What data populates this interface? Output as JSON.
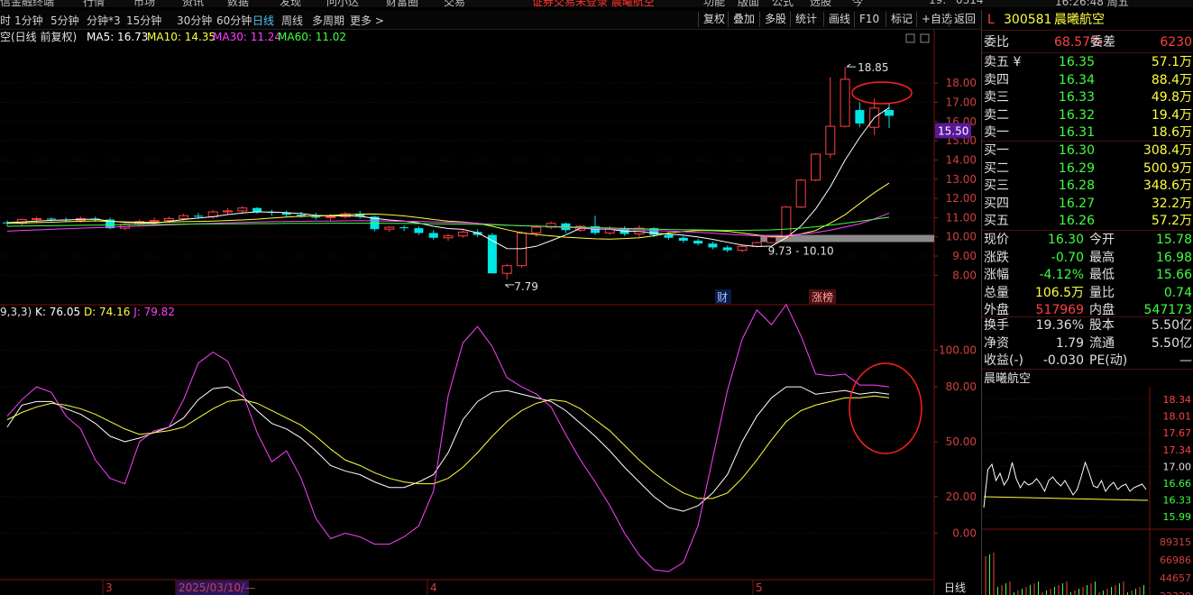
{
  "menubar": {
    "items": [
      "信金融终端",
      "行情",
      "市场",
      "资讯",
      "数据",
      "发现",
      "问小达",
      "财富圈",
      "交易",
      "证券交易未登录  晨曦航空",
      "功能",
      "版面",
      "公式",
      "选股",
      "今",
      "19:",
      "0314",
      "16:26:48 周五"
    ]
  },
  "toolbar": {
    "periods": [
      "时",
      "1分钟",
      "5分钟",
      "分钟*3",
      "15分钟",
      "30分钟",
      "60分钟",
      "日线",
      "周线",
      "多周期",
      "更多 >"
    ],
    "active_period": "日线",
    "buttons": [
      "复权",
      "叠加",
      "多股",
      "统计",
      "画线",
      "F10",
      "标记",
      "+自选",
      "返回"
    ]
  },
  "main_chart": {
    "title": "空(日线 前复权)",
    "ma_labels": [
      {
        "text": "MA5: 16.73",
        "color": "#ffffff"
      },
      {
        "text": "MA10: 14.35",
        "color": "#ffff40"
      },
      {
        "text": "MA30: 11.24",
        "color": "#ff40ff"
      },
      {
        "text": "MA60: 11.02",
        "color": "#40ff40"
      }
    ],
    "price_axis": [
      "18.00",
      "17.00",
      "16.00",
      "15.00",
      "14.00",
      "13.00",
      "12.00",
      "11.00",
      "10.00",
      "9.00",
      "8.00"
    ],
    "current_price_tag": "15.50",
    "high_label": "18.85",
    "low_label": "7.79",
    "range_label": "9.73 - 10.10",
    "badges": {
      "cai": "财",
      "zhangbang": "涨榜"
    }
  },
  "kdj": {
    "title": "9,3,3)  K: 76.05  D: 74.16  J: 79.82",
    "k_text": "K: 76.05",
    "d_text": "D: 74.16",
    "j_text": "J: 79.82",
    "axis": [
      "100.00",
      "80.00",
      "50.00",
      "20.00",
      "0.00"
    ]
  },
  "date_axis": {
    "labels": [
      "3",
      "2025/03/10/—",
      "4",
      "5"
    ],
    "period": "日线"
  },
  "quote": {
    "flag": "L",
    "code": "300581",
    "name": "晨曦航空",
    "weibi_label": "委比",
    "weibi_value": "68.57%",
    "weicha_label": "委差",
    "weicha_value": "6230",
    "asks": [
      {
        "label": "卖五 ¥",
        "price": "16.35",
        "vol": "57.1万"
      },
      {
        "label": "卖四",
        "price": "16.34",
        "vol": "88.4万"
      },
      {
        "label": "卖三",
        "price": "16.33",
        "vol": "49.8万"
      },
      {
        "label": "卖二",
        "price": "16.32",
        "vol": "19.4万"
      },
      {
        "label": "卖一",
        "price": "16.31",
        "vol": "18.6万"
      }
    ],
    "bids": [
      {
        "label": "买一",
        "price": "16.30",
        "vol": "308.4万"
      },
      {
        "label": "买二",
        "price": "16.29",
        "vol": "500.9万"
      },
      {
        "label": "买三",
        "price": "16.28",
        "vol": "348.6万"
      },
      {
        "label": "买四",
        "price": "16.27",
        "vol": "32.2万"
      },
      {
        "label": "买五",
        "price": "16.26",
        "vol": "57.2万"
      }
    ],
    "stats": [
      {
        "l1": "现价",
        "v1": "16.30",
        "c1": "#40ff40",
        "l2": "今开",
        "v2": "15.78",
        "c2": "#40ff40"
      },
      {
        "l1": "涨跌",
        "v1": "-0.70",
        "c1": "#40ff40",
        "l2": "最高",
        "v2": "16.98",
        "c2": "#40ff40"
      },
      {
        "l1": "涨幅",
        "v1": "-4.12%",
        "c1": "#40ff40",
        "l2": "最低",
        "v2": "15.66",
        "c2": "#40ff40"
      },
      {
        "l1": "总量",
        "v1": "106.5万",
        "c1": "#ffff40",
        "l2": "量比",
        "v2": "0.74",
        "c2": "#40ff40"
      },
      {
        "l1": "外盘",
        "v1": "517969",
        "c1": "#ff4040",
        "l2": "内盘",
        "v2": "547173",
        "c2": "#40ff40"
      },
      {
        "l1": "换手",
        "v1": "19.36%",
        "c1": "#e0e0e0",
        "l2": "股本",
        "v2": "5.50亿",
        "c2": "#e0e0e0"
      },
      {
        "l1": "净资",
        "v1": "1.79",
        "c1": "#e0e0e0",
        "l2": "流通",
        "v2": "5.50亿",
        "c2": "#e0e0e0"
      },
      {
        "l1": "收益(-)",
        "v1": "-0.030",
        "c1": "#e0e0e0",
        "l2": "PE(动)",
        "v2": "—",
        "c2": "#e0e0e0"
      }
    ],
    "mini_title": "晨曦航空",
    "mini_price_axis": [
      "18.34",
      "18.01",
      "17.67",
      "17.34",
      "17.00",
      "16.66",
      "16.33",
      "15.99"
    ],
    "mini_volume_axis": [
      "89315",
      "66986",
      "44657",
      "22329"
    ]
  },
  "colors": {
    "up": "#ff4040",
    "down": "#00e5e5",
    "ma5": "#ffffff",
    "ma10": "#ffff40",
    "ma30": "#ff40ff",
    "ma60": "#40ff40",
    "highlight": "#ff2020"
  },
  "chart_data": [
    {
      "type": "candlestick",
      "title": "空(日线 前复权)",
      "y_ticks": [
        18,
        17,
        16,
        15,
        14,
        13,
        12,
        11,
        10,
        9,
        8
      ],
      "ylim": [
        7.5,
        18.9
      ],
      "candles": [
        [
          10.75,
          10.85,
          10.55,
          10.7
        ],
        [
          10.7,
          10.95,
          10.6,
          10.9
        ],
        [
          10.9,
          11.05,
          10.75,
          10.95
        ],
        [
          10.95,
          11.0,
          10.8,
          10.9
        ],
        [
          10.9,
          11.0,
          10.75,
          10.85
        ],
        [
          10.85,
          11.05,
          10.75,
          10.95
        ],
        [
          10.95,
          11.05,
          10.8,
          10.9
        ],
        [
          10.9,
          11.0,
          10.4,
          10.45
        ],
        [
          10.45,
          10.7,
          10.35,
          10.65
        ],
        [
          10.65,
          10.9,
          10.55,
          10.8
        ],
        [
          10.8,
          11.0,
          10.65,
          10.85
        ],
        [
          10.85,
          11.05,
          10.75,
          10.95
        ],
        [
          10.95,
          11.2,
          10.85,
          11.1
        ],
        [
          11.1,
          11.25,
          10.95,
          11.05
        ],
        [
          11.05,
          11.4,
          10.95,
          11.3
        ],
        [
          11.3,
          11.5,
          11.15,
          11.35
        ],
        [
          11.35,
          11.6,
          11.2,
          11.5
        ],
        [
          11.5,
          11.55,
          11.2,
          11.3
        ],
        [
          11.3,
          11.4,
          11.1,
          11.25
        ],
        [
          11.25,
          11.35,
          11.05,
          11.15
        ],
        [
          11.15,
          11.3,
          11.0,
          11.05
        ],
        [
          11.05,
          11.25,
          10.9,
          11.0
        ],
        [
          11.0,
          11.2,
          10.85,
          11.05
        ],
        [
          11.05,
          11.3,
          10.95,
          11.2
        ],
        [
          11.2,
          11.35,
          10.95,
          11.05
        ],
        [
          11.05,
          11.1,
          10.3,
          10.4
        ],
        [
          10.4,
          10.55,
          10.25,
          10.5
        ],
        [
          10.5,
          10.6,
          10.3,
          10.45
        ],
        [
          10.45,
          10.55,
          10.1,
          10.2
        ],
        [
          10.2,
          10.35,
          9.85,
          9.95
        ],
        [
          9.95,
          10.15,
          9.8,
          10.05
        ],
        [
          10.05,
          10.35,
          9.95,
          10.25
        ],
        [
          10.25,
          10.4,
          10.0,
          10.1
        ],
        [
          10.1,
          10.2,
          8.1,
          8.1
        ],
        [
          8.1,
          8.6,
          7.79,
          8.5
        ],
        [
          8.5,
          10.3,
          8.4,
          10.2
        ],
        [
          10.2,
          10.6,
          10.0,
          10.5
        ],
        [
          10.5,
          10.8,
          10.4,
          10.7
        ],
        [
          10.7,
          10.75,
          10.2,
          10.35
        ],
        [
          10.35,
          10.6,
          10.25,
          10.55
        ],
        [
          10.55,
          11.1,
          10.1,
          10.2
        ],
        [
          10.2,
          10.55,
          10.1,
          10.45
        ],
        [
          10.45,
          10.55,
          10.05,
          10.15
        ],
        [
          10.15,
          10.6,
          10.0,
          10.45
        ],
        [
          10.45,
          10.5,
          10.0,
          10.1
        ],
        [
          10.1,
          10.25,
          9.85,
          9.95
        ],
        [
          9.95,
          10.05,
          9.7,
          9.8
        ],
        [
          9.8,
          9.9,
          9.55,
          9.65
        ],
        [
          9.65,
          9.75,
          9.35,
          9.45
        ],
        [
          9.45,
          9.55,
          9.2,
          9.3
        ],
        [
          9.3,
          9.6,
          9.2,
          9.5
        ],
        [
          9.5,
          9.75,
          9.45,
          9.7
        ],
        [
          9.7,
          10.1,
          9.65,
          10.0
        ],
        [
          10.0,
          11.6,
          9.95,
          11.55
        ],
        [
          11.55,
          13.0,
          11.5,
          12.95
        ],
        [
          12.95,
          14.35,
          12.9,
          14.3
        ],
        [
          14.3,
          18.3,
          14.1,
          15.75
        ],
        [
          15.75,
          18.85,
          15.7,
          18.2
        ],
        [
          16.6,
          17.0,
          15.7,
          15.9
        ],
        [
          15.7,
          17.2,
          15.3,
          16.7
        ],
        [
          16.6,
          16.98,
          15.66,
          16.3
        ]
      ],
      "ma_series": [
        {
          "name": "MA5",
          "values": [
            10.74,
            10.78,
            10.82,
            10.86,
            10.88,
            10.91,
            10.92,
            10.82,
            10.75,
            10.72,
            10.71,
            10.8,
            10.9,
            10.98,
            11.05,
            11.16,
            11.24,
            11.3,
            11.29,
            11.26,
            11.21,
            11.12,
            11.09,
            11.1,
            11.07,
            10.96,
            10.88,
            10.82,
            10.72,
            10.55,
            10.43,
            10.39,
            10.21,
            9.81,
            9.39,
            9.38,
            9.51,
            9.8,
            10.1,
            10.45,
            10.41,
            10.39,
            10.3,
            10.28,
            10.2,
            10.14,
            10.09,
            9.99,
            9.87,
            9.72,
            9.57,
            9.5,
            9.52,
            9.95,
            10.56,
            11.45,
            12.6,
            13.99,
            15.17,
            16.21,
            16.72
          ]
        },
        {
          "name": "MA10",
          "values": [
            10.7,
            10.72,
            10.74,
            10.76,
            10.79,
            10.81,
            10.83,
            10.8,
            10.78,
            10.76,
            10.75,
            10.77,
            10.79,
            10.8,
            10.82,
            10.85,
            10.88,
            10.92,
            10.98,
            11.03,
            11.07,
            11.08,
            11.11,
            11.15,
            11.18,
            11.19,
            11.15,
            11.09,
            11.0,
            10.9,
            10.82,
            10.77,
            10.7,
            10.55,
            10.37,
            10.21,
            10.12,
            10.05,
            9.98,
            9.94,
            9.9,
            9.88,
            9.91,
            9.95,
            10.05,
            10.2,
            10.28,
            10.33,
            10.32,
            10.29,
            10.2,
            10.1,
            9.99,
            10.03,
            10.15,
            10.33,
            10.71,
            11.15,
            11.73,
            12.3,
            12.8
          ]
        },
        {
          "name": "MA30",
          "values": [
            10.3,
            10.33,
            10.36,
            10.39,
            10.42,
            10.45,
            10.48,
            10.5,
            10.53,
            10.56,
            10.59,
            10.62,
            10.65,
            10.68,
            10.7,
            10.73,
            10.75,
            10.77,
            10.79,
            10.8,
            10.81,
            10.82,
            10.82,
            10.83,
            10.84,
            10.83,
            10.82,
            10.81,
            10.8,
            10.78,
            10.76,
            10.74,
            10.7,
            10.65,
            10.61,
            10.58,
            10.55,
            10.52,
            10.49,
            10.46,
            10.43,
            10.4,
            10.38,
            10.36,
            10.33,
            10.3,
            10.27,
            10.23,
            10.19,
            10.14,
            10.09,
            10.05,
            10.03,
            10.07,
            10.14,
            10.22,
            10.35,
            10.51,
            10.68,
            10.93,
            11.24
          ]
        },
        {
          "name": "MA60",
          "values": [
            10.55,
            10.56,
            10.57,
            10.58,
            10.59,
            10.6,
            10.61,
            10.62,
            10.63,
            10.64,
            10.64,
            10.65,
            10.66,
            10.67,
            10.67,
            10.68,
            10.68,
            10.69,
            10.69,
            10.7,
            10.7,
            10.7,
            10.71,
            10.71,
            10.71,
            10.71,
            10.7,
            10.7,
            10.69,
            10.68,
            10.67,
            10.66,
            10.65,
            10.63,
            10.6,
            10.58,
            10.56,
            10.54,
            10.52,
            10.5,
            10.48,
            10.46,
            10.44,
            10.42,
            10.4,
            10.38,
            10.37,
            10.36,
            10.35,
            10.34,
            10.34,
            10.35,
            10.36,
            10.4,
            10.45,
            10.52,
            10.61,
            10.71,
            10.81,
            10.92,
            11.02
          ]
        }
      ]
    },
    {
      "type": "line",
      "title": "9,3,3)  K: 76.05  D: 74.16  J: 79.82",
      "y_ticks": [
        100,
        80,
        50,
        20,
        0
      ],
      "ylim": [
        -20,
        118
      ],
      "series": [
        {
          "name": "K",
          "values": [
            58,
            70,
            72,
            72,
            68,
            65,
            60,
            53,
            50,
            52,
            55,
            58,
            63,
            73,
            79,
            80,
            75,
            67,
            60,
            57,
            52,
            45,
            37,
            34,
            32,
            28,
            25,
            25,
            28,
            32,
            44,
            62,
            72,
            77,
            78,
            76,
            74,
            72,
            67,
            60,
            53,
            45,
            36,
            28,
            20,
            14,
            12,
            15,
            22,
            32,
            50,
            64,
            74,
            80,
            80,
            76,
            77,
            78,
            76,
            77,
            76
          ]
        },
        {
          "name": "D",
          "values": [
            62,
            66,
            69,
            71,
            70,
            68,
            65,
            61,
            57,
            54,
            55,
            56,
            58,
            63,
            68,
            72,
            73,
            71,
            67,
            63,
            59,
            53,
            46,
            40,
            37,
            33,
            30,
            28,
            27,
            27,
            30,
            36,
            44,
            53,
            61,
            67,
            71,
            73,
            72,
            68,
            62,
            56,
            48,
            40,
            33,
            27,
            22,
            19,
            19,
            22,
            30,
            40,
            51,
            61,
            67,
            70,
            72,
            74,
            74,
            75,
            74
          ]
        },
        {
          "name": "J",
          "values": [
            64,
            73,
            80,
            77,
            64,
            57,
            40,
            30,
            27,
            50,
            56,
            58,
            73,
            93,
            99,
            94,
            77,
            55,
            39,
            45,
            30,
            8,
            -3,
            0,
            -2,
            -6,
            -6,
            -2,
            4,
            23,
            75,
            104,
            113,
            102,
            85,
            80,
            76,
            69,
            54,
            40,
            28,
            15,
            0,
            -12,
            -20,
            -21,
            -16,
            4,
            41,
            78,
            106,
            122,
            114,
            125,
            108,
            87,
            86,
            87,
            81,
            81,
            80
          ]
        }
      ]
    }
  ]
}
